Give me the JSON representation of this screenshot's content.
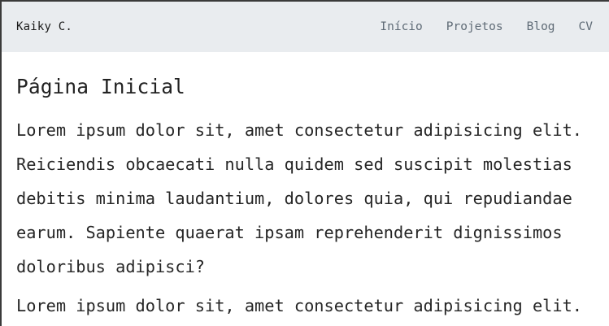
{
  "navbar": {
    "brand": "Kaiky C.",
    "links": [
      {
        "label": "Início"
      },
      {
        "label": "Projetos"
      },
      {
        "label": "Blog"
      },
      {
        "label": "CV"
      }
    ]
  },
  "main": {
    "title": "Página Inicial",
    "paragraphs": [
      "Lorem ipsum dolor sit, amet consectetur adipisicing elit. Reiciendis obcaecati nulla quidem sed suscipit molestias debitis minima laudantium, dolores quia, qui repudiandae earum. Sapiente quaerat ipsam reprehenderit dignissimos doloribus adipisci?",
      "Lorem ipsum dolor sit, amet consectetur adipisicing elit."
    ]
  }
}
